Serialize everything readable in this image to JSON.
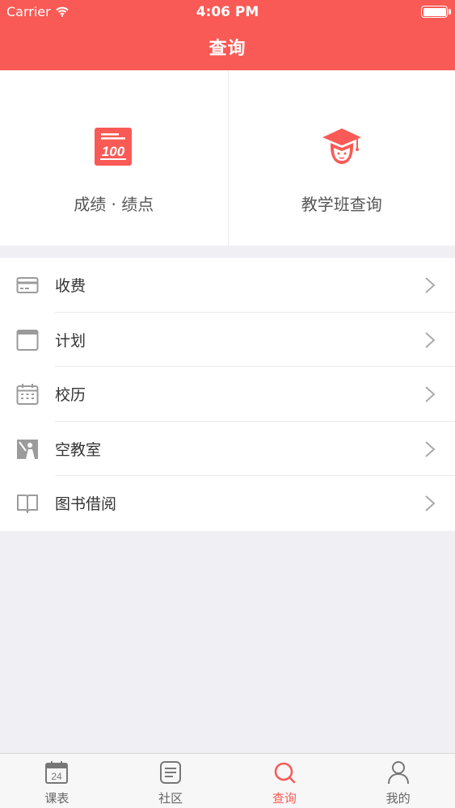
{
  "status_bar": {
    "carrier": "Carrier",
    "time": "4:06 PM"
  },
  "header": {
    "title": "查询"
  },
  "top_grid": [
    {
      "label": "成绩 · 绩点",
      "icon": "score-100-icon"
    },
    {
      "label": "教学班查询",
      "icon": "graduate-cap-icon"
    }
  ],
  "list": [
    {
      "label": "收费",
      "icon": "card-icon"
    },
    {
      "label": "计划",
      "icon": "window-icon"
    },
    {
      "label": "校历",
      "icon": "calendar-icon"
    },
    {
      "label": "空教室",
      "icon": "classroom-icon"
    },
    {
      "label": "图书借阅",
      "icon": "book-icon"
    }
  ],
  "tabbar": {
    "active_tab": "查询",
    "calendar_day": "24",
    "tabs": [
      {
        "label": "课表",
        "icon": "calendar-icon"
      },
      {
        "label": "社区",
        "icon": "notes-icon"
      },
      {
        "label": "查询",
        "icon": "search-icon"
      },
      {
        "label": "我的",
        "icon": "person-icon"
      }
    ]
  },
  "colors": {
    "accent": "#fa5a55",
    "background": "#efeff4",
    "icon_gray": "#9b9b9b"
  }
}
